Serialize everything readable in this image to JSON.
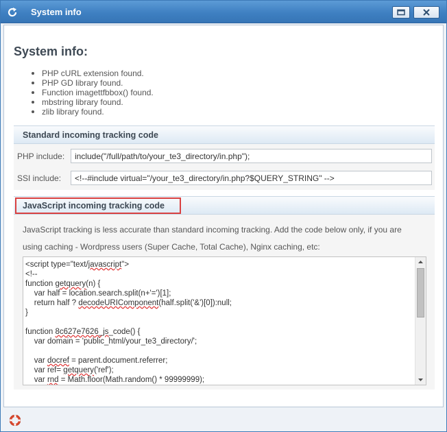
{
  "window": {
    "title": "System info",
    "icons": {
      "refresh": "refresh-icon",
      "maximize": "maximize-icon",
      "close": "close-icon",
      "help": "lifebuoy-icon"
    }
  },
  "content": {
    "heading": "System info:",
    "checks": [
      "PHP cURL extension found.",
      "PHP GD library found.",
      "Function imagettfbbox() found.",
      "mbstring library found.",
      "zlib library found."
    ]
  },
  "standard": {
    "header": "Standard incoming tracking code",
    "php_label": "PHP include:",
    "php_value": "include(\"/full/path/to/your_te3_directory/in.php\");",
    "ssi_label": "SSI include:",
    "ssi_value": "<!--#include virtual=\"/your_te3_directory/in.php?$QUERY_STRING\" -->"
  },
  "javascript": {
    "header": "JavaScript incoming tracking code",
    "desc_line1": "JavaScript tracking is less accurate than standard incoming tracking. Add the code below only, if you are",
    "desc_line2": "using caching - Wordpress users (Super Cache, Total Cache), Nginx caching, etc:",
    "code_lines": [
      "<script type=\"text/javascript\">",
      "<!--",
      "function getquery(n) {",
      "    var half = location.search.split(n+'=')[1];",
      "    return half ? decodeURIComponent(half.split('&')[0]):null;",
      "}",
      "",
      "function 8c627e7626_js_code() {",
      "    var domain = 'public_html/your_te3_directory/';",
      "",
      "    var docref = parent.document.referrer;",
      "    var ref= getquery('ref');",
      "    var rnd = Math.floor(Math.random() * 99999999);"
    ]
  },
  "colors": {
    "titlebar": "#3f80c2",
    "highlight_border": "#d94040",
    "section_header": "#dde9f4"
  }
}
